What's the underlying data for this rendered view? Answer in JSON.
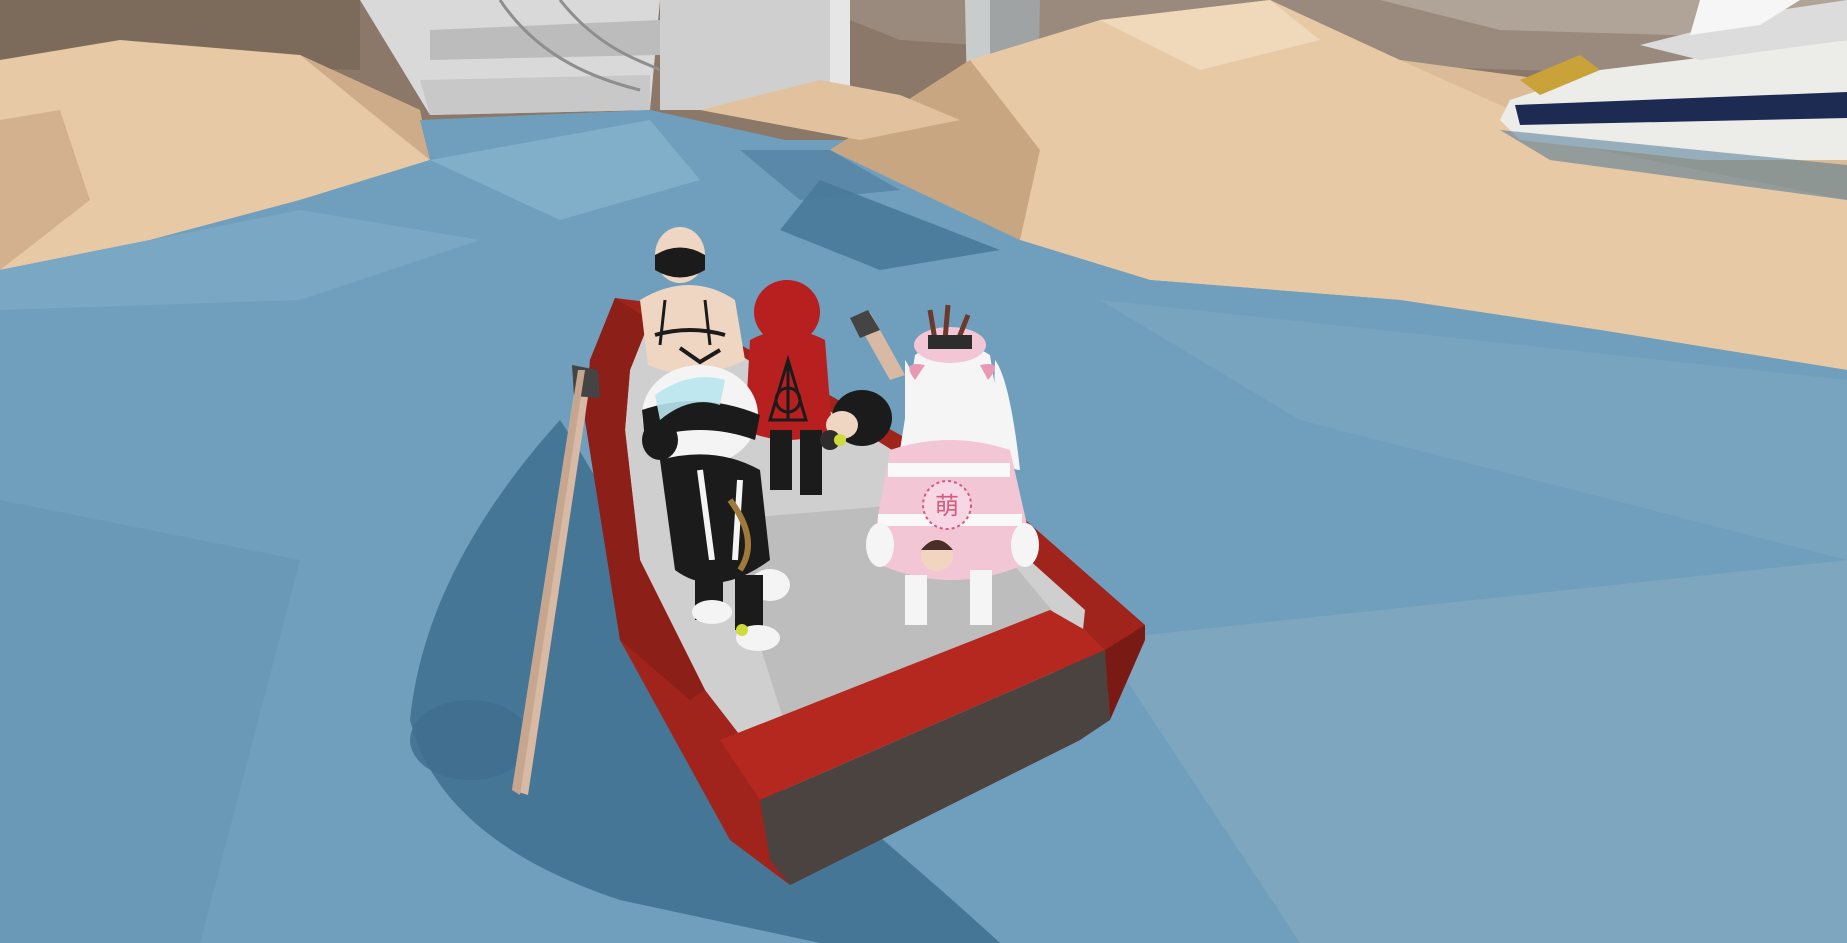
{
  "scene": {
    "type": "3d-game-viewport",
    "hud_text": [],
    "objects": {
      "water": "water-icon",
      "sand_dunes": "sand-icon",
      "rowboat": "boat-icon",
      "oar": "oar-icon",
      "speedboat": "speedboat-icon",
      "dock": "dock-icon",
      "pillar": "pillar-icon"
    }
  },
  "characters": [
    {
      "role": "bald-swimsuit-character"
    },
    {
      "role": "red-hooded-character"
    },
    {
      "role": "panda-helmet-character",
      "shirt_text": ""
    },
    {
      "role": "pink-bunny-character",
      "shirt_glyph": "萌"
    },
    {
      "role": "small-black-haired-character"
    }
  ],
  "colors": {
    "water": "#6f9fbd",
    "water_shadow": "#3f6f8f",
    "sand": "#e8c9a6",
    "sand_shade": "#c9a682",
    "boat_red": "#a0241c",
    "boat_inner": "#cfcfcf",
    "boat_stern": "#4a4340",
    "oar": "#d8b9a3",
    "pink": "#f3c6d6",
    "character_red": "#b81f1f"
  }
}
